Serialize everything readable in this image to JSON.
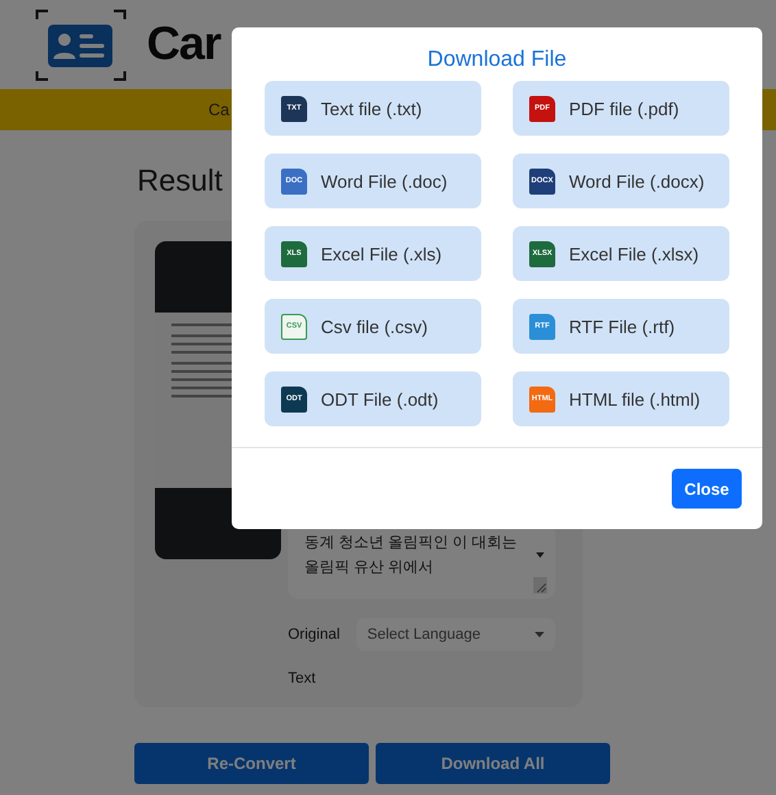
{
  "header": {
    "brand": "Car"
  },
  "banner": {
    "text": "Ca"
  },
  "result": {
    "title": "Result",
    "text_lines": [
      "동계 청소년 올림픽인 이 대회는",
      "올림픽 유산 위에서"
    ],
    "original_label": "Original",
    "language_select": {
      "placeholder": "Select Language"
    },
    "text_label": "Text"
  },
  "actions": [
    "Re-Convert",
    "Download All"
  ],
  "modal": {
    "title": "Download File",
    "options": [
      {
        "label": "Text file (.txt)",
        "icon_label": "TXT",
        "color": "#1d3557",
        "kind": "solid"
      },
      {
        "label": "PDF file (.pdf)",
        "icon_label": "PDF",
        "color": "#c4120f",
        "kind": "solid"
      },
      {
        "label": "Word File (.doc)",
        "icon_label": "DOC",
        "color": "#3a6fc4",
        "kind": "solid"
      },
      {
        "label": "Word File (.docx)",
        "icon_label": "DOCX",
        "color": "#1f3f7a",
        "kind": "solid"
      },
      {
        "label": "Excel File (.xls)",
        "icon_label": "XLS",
        "color": "#1e6b3d",
        "kind": "solid"
      },
      {
        "label": "Excel File (.xlsx)",
        "icon_label": "XLSX",
        "color": "#1e6b3d",
        "kind": "solid"
      },
      {
        "label": "Csv file (.csv)",
        "icon_label": "CSV",
        "color": "#3c9a55",
        "kind": "outline"
      },
      {
        "label": "RTF File (.rtf)",
        "icon_label": "RTF",
        "color": "#2a8fd6",
        "kind": "solid"
      },
      {
        "label": "ODT File (.odt)",
        "icon_label": "ODT",
        "color": "#0d3a52",
        "kind": "solid"
      },
      {
        "label": "HTML file (.html)",
        "icon_label": "HTML",
        "color": "#f26a12",
        "kind": "solid"
      }
    ],
    "close": "Close"
  }
}
